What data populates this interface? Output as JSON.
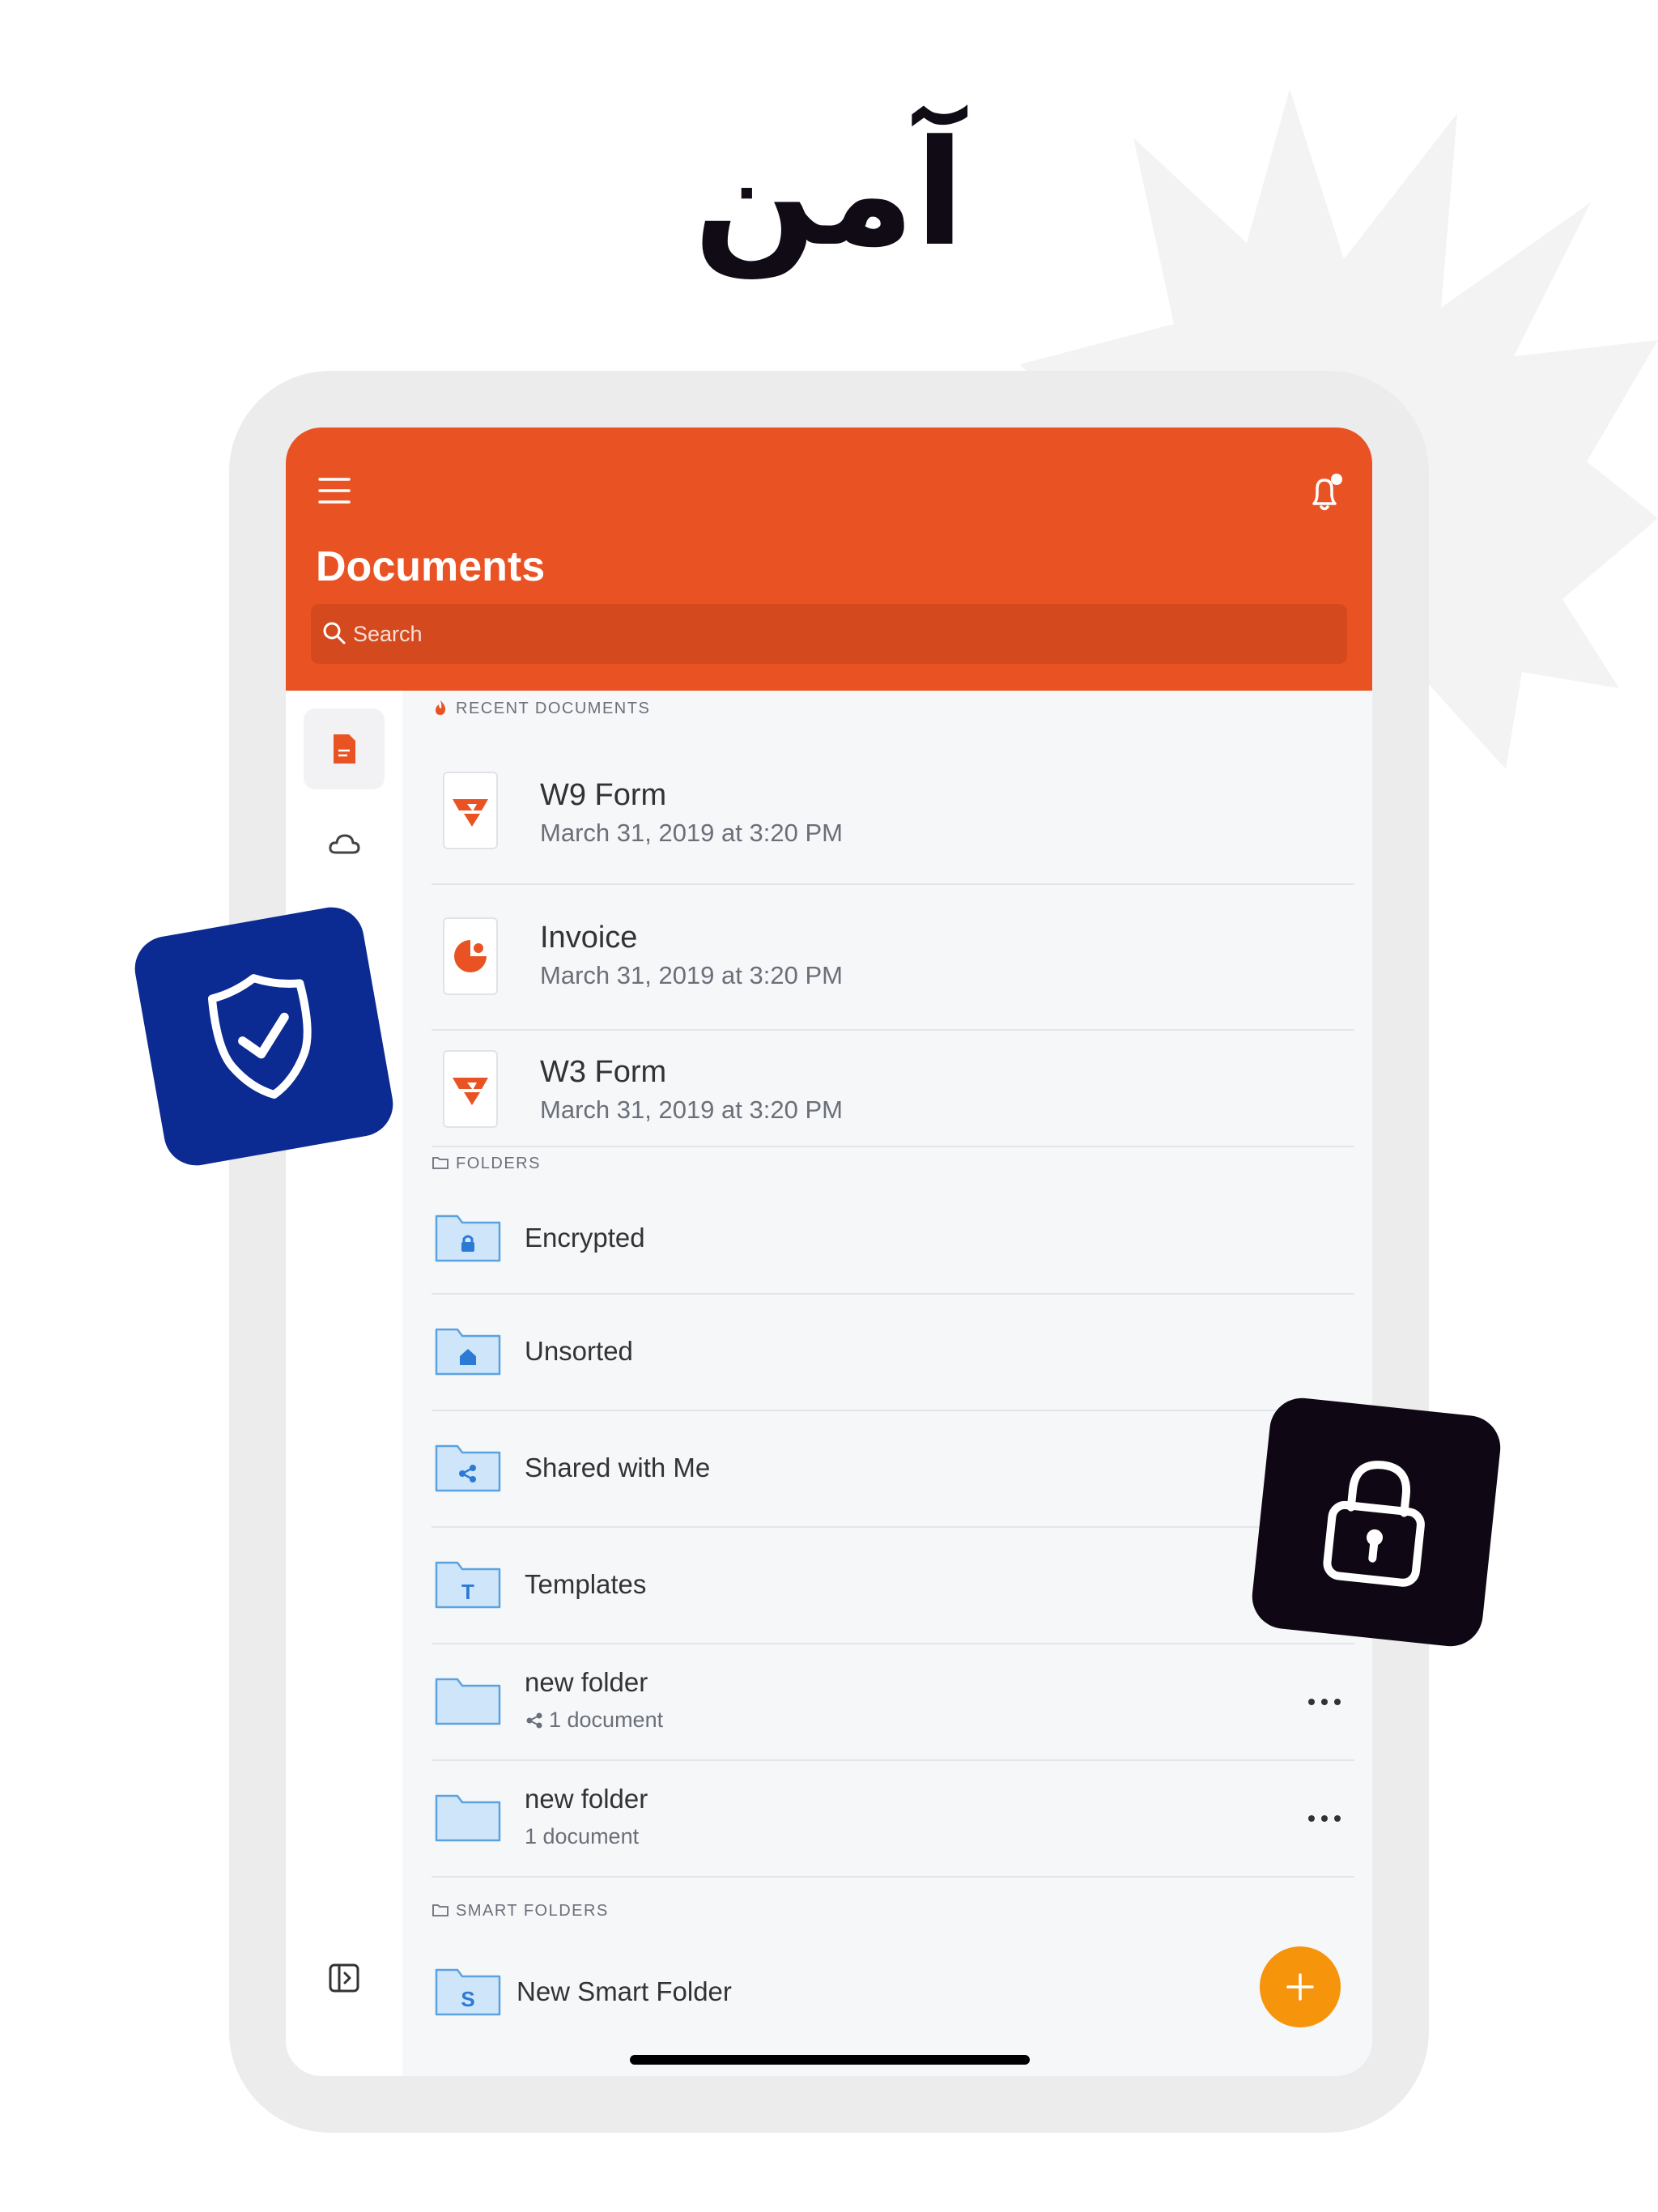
{
  "headline": "آمن",
  "colors": {
    "header": "#e95323",
    "search_bg": "#d5491e",
    "fab": "#f6940b",
    "folder_fill": "#cfe5f9",
    "folder_stroke": "#5ba2e0",
    "shield_badge": "#0b2a92",
    "lock_badge": "#0f0714"
  },
  "header": {
    "title": "Documents",
    "menu_icon": "hamburger-menu-icon",
    "notification_icon": "bell-icon",
    "search": {
      "placeholder": "Search",
      "value": ""
    }
  },
  "sidebar": {
    "items": [
      {
        "icon": "document-icon",
        "active": true
      },
      {
        "icon": "cloud-icon",
        "active": false
      }
    ],
    "footer_icon": "sidebar-toggle-icon"
  },
  "recent": {
    "label": "RECENT DOCUMENTS",
    "items": [
      {
        "title": "W9 Form",
        "date": "March 31, 2019 at 3:20 PM",
        "icon": "pdf-form-icon"
      },
      {
        "title": "Invoice",
        "date": "March 31, 2019 at 3:20 PM",
        "icon": "invoice-chart-icon"
      },
      {
        "title": "W3 Form",
        "date": "March 31, 2019 at 3:20 PM",
        "icon": "pdf-form-icon"
      }
    ]
  },
  "folders": {
    "label": "FOLDERS",
    "items": [
      {
        "name": "Encrypted",
        "glyph": "lock-icon"
      },
      {
        "name": "Unsorted",
        "glyph": "home-icon"
      },
      {
        "name": "Shared with Me",
        "glyph": "share-icon"
      },
      {
        "name": "Templates",
        "glyph": "T"
      },
      {
        "name": "new folder",
        "subtitle": "1 document",
        "shared": true
      },
      {
        "name": "new folder",
        "subtitle": "1 document",
        "shared": false
      }
    ]
  },
  "smart_folders": {
    "label": "SMART FOLDERS",
    "items": [
      {
        "name": "New Smart Folder",
        "glyph": "S"
      }
    ]
  },
  "fab": {
    "icon": "plus-icon"
  },
  "badges": [
    "shield-check-icon",
    "padlock-icon"
  ]
}
